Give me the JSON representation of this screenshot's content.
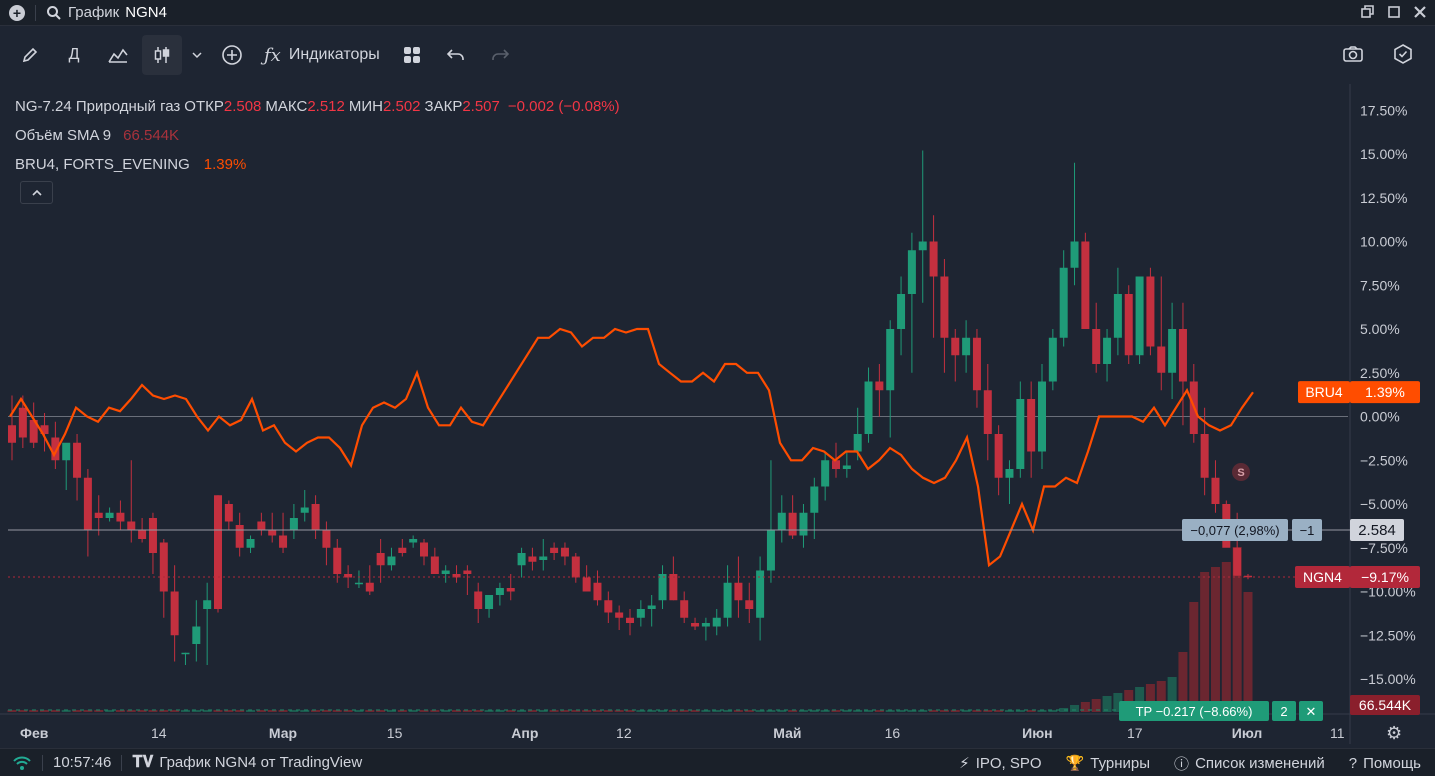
{
  "titlebar": {
    "title": "График",
    "symbol": "NGN4"
  },
  "toolbar": {
    "interval_label": "Д",
    "indicators_label": "Индикаторы"
  },
  "legend": {
    "main": {
      "name": "NG-7.24 Природный газ",
      "open_label": "ОТКР",
      "open": "2.508",
      "high_label": "МАКС",
      "high": "2.512",
      "low_label": "МИН",
      "low": "2.502",
      "close_label": "ЗАКР",
      "close": "2.507",
      "change": "−0.002 (−0.08%)"
    },
    "volume": {
      "name": "Объём SMA 9",
      "value": "66.544K"
    },
    "compare": {
      "name": "BRU4, FORTS_EVENING",
      "value": "1.39%"
    }
  },
  "axis": {
    "y_ticks": [
      "17.50%",
      "15.00%",
      "12.50%",
      "10.00%",
      "7.50%",
      "5.00%",
      "2.50%",
      "0.00%",
      "−2.50%",
      "−5.00%",
      "−7.50%",
      "−10.00%",
      "−12.50%",
      "−15.00%"
    ],
    "y_values": [
      17.5,
      15,
      12.5,
      10,
      7.5,
      5,
      2.5,
      0,
      -2.5,
      -5,
      -7.5,
      -10,
      -12.5,
      -15
    ],
    "x_ticks": [
      {
        "label": "Фев",
        "pos": 0.0
      },
      {
        "label": "14",
        "pos": 0.1
      },
      {
        "label": "Мар",
        "pos": 0.19
      },
      {
        "label": "15",
        "pos": 0.28
      },
      {
        "label": "Апр",
        "pos": 0.375
      },
      {
        "label": "12",
        "pos": 0.455
      },
      {
        "label": "Май",
        "pos": 0.575
      },
      {
        "label": "16",
        "pos": 0.66
      },
      {
        "label": "Июн",
        "pos": 0.765
      },
      {
        "label": "17",
        "pos": 0.845
      },
      {
        "label": "Июл",
        "pos": 0.925
      },
      {
        "label": "11",
        "pos": 1.0
      }
    ]
  },
  "labels": {
    "bru4": {
      "name": "BRU4",
      "value": "1.39%",
      "color": "#ff4d00"
    },
    "ngn4": {
      "name": "NGN4",
      "value": "−9.17%",
      "color": "#b2283a"
    },
    "crosshair_price": "2.584",
    "crosshair_measure": "−0,077 (2,98%)",
    "crosshair_count": "−1",
    "volume_sma": "66.544K",
    "tp_label": "TP −0.217 (−8.66%)",
    "tp_count": "2",
    "s_marker": "S"
  },
  "chart_data": {
    "type": "candlestick",
    "ylim": [
      -17,
      19
    ],
    "main_series": {
      "name": "NGN4",
      "percent_ohlc": [
        [
          -0.5,
          1.2,
          -2.5,
          -1.5
        ],
        [
          0.5,
          1.2,
          -1.8,
          -1.2
        ],
        [
          -0.2,
          0.8,
          -1.8,
          -1.5
        ],
        [
          -0.5,
          0.2,
          -2.0,
          -1.0
        ],
        [
          -1.2,
          -0.3,
          -3.0,
          -2.5
        ],
        [
          -2.5,
          -1.8,
          -4.2,
          -1.5
        ],
        [
          -1.5,
          -1.0,
          -4.8,
          -3.5
        ],
        [
          -3.5,
          -3.0,
          -8.0,
          -6.5
        ],
        [
          -5.5,
          -4.5,
          -6.8,
          -5.8
        ],
        [
          -5.8,
          -5.2,
          -6.0,
          -5.5
        ],
        [
          -5.5,
          -4.8,
          -6.5,
          -6.0
        ],
        [
          -6.0,
          -2.5,
          -7.2,
          -6.5
        ],
        [
          -6.5,
          -5.8,
          -7.2,
          -7.0
        ],
        [
          -5.8,
          -5.5,
          -9.0,
          -7.8
        ],
        [
          -7.2,
          -7.0,
          -11.5,
          -10.0
        ],
        [
          -10.0,
          -8.5,
          -14.0,
          -12.5
        ],
        [
          -13.5,
          -13.5,
          -14.2,
          -13.5
        ],
        [
          -13.0,
          -10.5,
          -14.0,
          -12.0
        ],
        [
          -11.0,
          -9.5,
          -14.2,
          -10.5
        ],
        [
          -4.5,
          -4.5,
          -11.2,
          -11.0
        ],
        [
          -5.0,
          -4.8,
          -6.5,
          -6.0
        ],
        [
          -6.2,
          -5.5,
          -8.0,
          -7.5
        ],
        [
          -7.5,
          -6.8,
          -7.8,
          -7.0
        ],
        [
          -6.0,
          -5.5,
          -6.8,
          -6.5
        ],
        [
          -6.5,
          -5.5,
          -7.2,
          -6.8
        ],
        [
          -6.8,
          -5.5,
          -7.8,
          -7.5
        ],
        [
          -6.5,
          -5.0,
          -7.0,
          -5.8
        ],
        [
          -5.5,
          -4.2,
          -6.0,
          -5.2
        ],
        [
          -5.0,
          -4.5,
          -7.0,
          -6.5
        ],
        [
          -6.5,
          -6.0,
          -8.5,
          -7.5
        ],
        [
          -7.5,
          -7.0,
          -9.5,
          -9.0
        ],
        [
          -9.0,
          -8.5,
          -9.8,
          -9.2
        ],
        [
          -9.5,
          -8.8,
          -9.8,
          -9.5
        ],
        [
          -9.5,
          -8.5,
          -10.2,
          -10.0
        ],
        [
          -7.8,
          -7.0,
          -9.5,
          -8.5
        ],
        [
          -8.5,
          -7.5,
          -8.8,
          -8.0
        ],
        [
          -7.5,
          -7.0,
          -8.0,
          -7.8
        ],
        [
          -7.2,
          -6.8,
          -7.5,
          -7.0
        ],
        [
          -7.2,
          -7.0,
          -8.5,
          -8.0
        ],
        [
          -8.0,
          -7.5,
          -9.0,
          -9.0
        ],
        [
          -9.0,
          -8.5,
          -9.5,
          -8.8
        ],
        [
          -9.0,
          -8.5,
          -9.5,
          -9.2
        ],
        [
          -8.8,
          -8.5,
          -10.2,
          -9.0
        ],
        [
          -10.0,
          -9.5,
          -11.8,
          -11.0
        ],
        [
          -11.0,
          -10.5,
          -11.5,
          -10.2
        ],
        [
          -10.2,
          -9.5,
          -10.8,
          -9.8
        ],
        [
          -9.8,
          -9.0,
          -10.5,
          -10.0
        ],
        [
          -8.5,
          -7.5,
          -9.2,
          -7.8
        ],
        [
          -8.0,
          -7.5,
          -8.8,
          -8.3
        ],
        [
          -8.2,
          -7.0,
          -8.8,
          -8.0
        ],
        [
          -7.5,
          -7.2,
          -8.2,
          -7.8
        ],
        [
          -7.5,
          -7.2,
          -8.5,
          -8.0
        ],
        [
          -8.0,
          -7.8,
          -9.5,
          -9.2
        ],
        [
          -9.2,
          -8.5,
          -10.0,
          -10.0
        ],
        [
          -9.5,
          -8.8,
          -10.8,
          -10.5
        ],
        [
          -10.5,
          -10.0,
          -11.8,
          -11.2
        ],
        [
          -11.2,
          -10.8,
          -12.2,
          -11.5
        ],
        [
          -11.5,
          -11.0,
          -12.5,
          -11.8
        ],
        [
          -11.5,
          -10.5,
          -12.0,
          -11.0
        ],
        [
          -11.0,
          -10.2,
          -12.0,
          -10.8
        ],
        [
          -10.5,
          -8.5,
          -11.0,
          -9.0
        ],
        [
          -9.0,
          -8.0,
          -10.5,
          -10.5
        ],
        [
          -10.5,
          -10.0,
          -11.8,
          -11.5
        ],
        [
          -11.8,
          -11.5,
          -12.2,
          -12.0
        ],
        [
          -12.0,
          -11.5,
          -12.8,
          -11.8
        ],
        [
          -12.0,
          -11.0,
          -12.5,
          -11.5
        ],
        [
          -11.5,
          -8.5,
          -12.0,
          -9.5
        ],
        [
          -9.5,
          -8.0,
          -11.5,
          -10.5
        ],
        [
          -10.5,
          -9.5,
          -11.8,
          -11.0
        ],
        [
          -11.5,
          -8.0,
          -12.8,
          -8.8
        ],
        [
          -8.8,
          -2.5,
          -9.5,
          -6.5
        ],
        [
          -6.5,
          -4.5,
          -7.2,
          -5.5
        ],
        [
          -5.5,
          -4.5,
          -7.0,
          -6.8
        ],
        [
          -6.8,
          -5.0,
          -7.5,
          -5.5
        ],
        [
          -5.5,
          -3.5,
          -7.0,
          -4.0
        ],
        [
          -4.0,
          -2.0,
          -4.8,
          -2.5
        ],
        [
          -2.5,
          -1.5,
          -3.5,
          -3.0
        ],
        [
          -3.0,
          -2.0,
          -3.5,
          -2.8
        ],
        [
          -2.0,
          0.5,
          -2.5,
          -1.0
        ],
        [
          -1.0,
          2.8,
          -1.5,
          2.0
        ],
        [
          2.0,
          3.0,
          0.0,
          1.5
        ],
        [
          1.5,
          5.5,
          -1.2,
          5.0
        ],
        [
          5.0,
          8.0,
          3.5,
          7.0
        ],
        [
          7.0,
          10.5,
          2.5,
          9.5
        ],
        [
          9.5,
          15.2,
          6.5,
          10.0
        ],
        [
          10.0,
          11.5,
          4.5,
          8.0
        ],
        [
          8.0,
          9.0,
          2.5,
          4.5
        ],
        [
          4.5,
          5.0,
          2.0,
          3.5
        ],
        [
          3.5,
          5.5,
          2.5,
          4.5
        ],
        [
          4.5,
          5.0,
          0.5,
          1.5
        ],
        [
          1.5,
          3.0,
          -2.5,
          -1.0
        ],
        [
          -1.0,
          -0.5,
          -4.5,
          -3.5
        ],
        [
          -3.5,
          -2.5,
          -5.0,
          -3.0
        ],
        [
          -3.0,
          2.0,
          -3.5,
          1.0
        ],
        [
          1.0,
          2.0,
          -3.5,
          -2.0
        ],
        [
          -2.0,
          3.0,
          -3.0,
          2.0
        ],
        [
          2.0,
          5.0,
          1.5,
          4.5
        ],
        [
          4.5,
          9.5,
          4.0,
          8.5
        ],
        [
          8.5,
          14.5,
          7.5,
          10.0
        ],
        [
          10.0,
          10.5,
          5.5,
          5.0
        ],
        [
          5.0,
          6.5,
          2.5,
          3.0
        ],
        [
          3.0,
          5.0,
          2.0,
          4.5
        ],
        [
          4.5,
          8.5,
          3.5,
          7.0
        ],
        [
          7.0,
          7.5,
          3.0,
          3.5
        ],
        [
          3.5,
          8.0,
          3.0,
          8.0
        ],
        [
          8.0,
          8.5,
          3.5,
          4.0
        ],
        [
          4.0,
          8.0,
          1.5,
          2.5
        ],
        [
          2.5,
          6.5,
          1.0,
          5.0
        ],
        [
          5.0,
          6.5,
          -0.5,
          2.0
        ],
        [
          2.0,
          3.0,
          -1.5,
          -1.0
        ],
        [
          -1.0,
          0.5,
          -4.5,
          -3.5
        ],
        [
          -3.5,
          -2.5,
          -5.5,
          -5.0
        ],
        [
          -5.0,
          -4.8,
          -5.5,
          -7.5
        ],
        [
          -7.5,
          -5.5,
          -9.0,
          -9.1
        ],
        [
          -9.1,
          -9.0,
          -9.3,
          -9.17
        ]
      ]
    },
    "compare_series": {
      "name": "BRU4",
      "percent": [
        0.0,
        1.0,
        0.0,
        -1.0,
        -2.2,
        -1.0,
        0.5,
        0.0,
        -0.3,
        0.5,
        0.3,
        1.0,
        1.8,
        1.2,
        1.0,
        1.2,
        1.0,
        0.0,
        -0.8,
        0.0,
        -0.5,
        -0.2,
        1.0,
        -0.8,
        -0.5,
        -1.5,
        -2.0,
        -1.5,
        -1.2,
        -1.2,
        -1.8,
        -2.8,
        -0.5,
        0.5,
        0.8,
        0.5,
        1.0,
        2.5,
        0.5,
        -0.5,
        -0.5,
        0.5,
        -0.3,
        -0.5,
        0.5,
        1.5,
        2.5,
        3.5,
        4.5,
        4.5,
        5.0,
        4.8,
        4.0,
        4.5,
        4.5,
        5.0,
        4.8,
        5.0,
        5.0,
        3.0,
        2.5,
        2.0,
        2.0,
        2.5,
        2.0,
        3.0,
        3.0,
        2.5,
        2.5,
        1.5,
        -1.5,
        -2.5,
        -2.5,
        -1.8,
        -2.0,
        -2.5,
        -2.0,
        -2.0,
        -3.0,
        -2.5,
        -1.8,
        -2.2,
        -3.0,
        -3.5,
        -3.8,
        -3.5,
        -2.5,
        -1.2,
        -4.0,
        -8.5,
        -8.0,
        -6.5,
        -5.0,
        -6.5,
        -4.0,
        -4.0,
        -3.5,
        -3.8,
        -2.0,
        0.0,
        0.0,
        0.0,
        0.0,
        -0.3,
        0.5,
        -0.5,
        0.5,
        1.5,
        0.0,
        -0.5,
        -0.8,
        -0.5,
        0.5,
        1.39
      ]
    },
    "volume_scale_note": "relative volume bars at right edge"
  }
}
